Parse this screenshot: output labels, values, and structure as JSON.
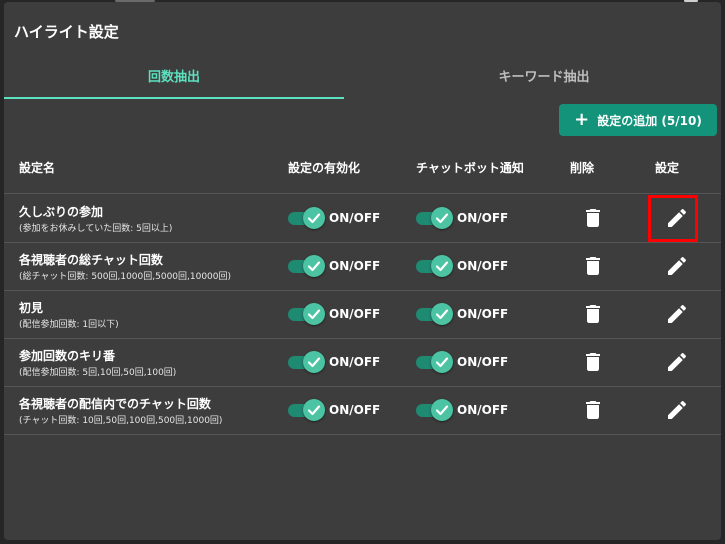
{
  "dialog": {
    "title": "ハイライト設定",
    "tabs": [
      {
        "label": "回数抽出",
        "active": true
      },
      {
        "label": "キーワード抽出",
        "active": false
      }
    ],
    "add_button": {
      "label": "設定の追加 (5/10)",
      "icon": "plus-icon"
    },
    "columns": {
      "name": "設定名",
      "enabled": "設定の有効化",
      "chatbot": "チャットボット通知",
      "delete": "削除",
      "edit": "設定"
    },
    "rows": [
      {
        "name": "久しぶりの参加",
        "desc": "(参加をお休みしていた回数: 5回以上)",
        "enabled_label": "ON/OFF",
        "chatbot_label": "ON/OFF",
        "enabled_on": true,
        "chatbot_on": true
      },
      {
        "name": "各視聴者の総チャット回数",
        "desc": "(総チャット回数: 500回,1000回,5000回,10000回)",
        "enabled_label": "ON/OFF",
        "chatbot_label": "ON/OFF",
        "enabled_on": true,
        "chatbot_on": true
      },
      {
        "name": "初見",
        "desc": "(配信参加回数: 1回以下)",
        "enabled_label": "ON/OFF",
        "chatbot_label": "ON/OFF",
        "enabled_on": true,
        "chatbot_on": true
      },
      {
        "name": "参加回数のキリ番",
        "desc": "(配信参加回数: 5回,10回,50回,100回)",
        "enabled_label": "ON/OFF",
        "chatbot_label": "ON/OFF",
        "enabled_on": true,
        "chatbot_on": true
      },
      {
        "name": "各視聴者の配信内でのチャット回数",
        "desc": "(チャット回数: 10回,50回,100回,500回,1000回)",
        "enabled_label": "ON/OFF",
        "chatbot_label": "ON/OFF",
        "enabled_on": true,
        "chatbot_on": true
      }
    ],
    "highlighted_row_index": 0
  },
  "colors": {
    "accent": "#5de0bf",
    "button": "#12937a",
    "toggle_track": "#1f8a72",
    "toggle_knob": "#4cc3a2",
    "highlight": "#ff0000",
    "dialog_bg": "#3d3d3d"
  },
  "icons": {
    "check": "check-icon",
    "delete": "trash-icon",
    "edit": "pencil-icon"
  }
}
